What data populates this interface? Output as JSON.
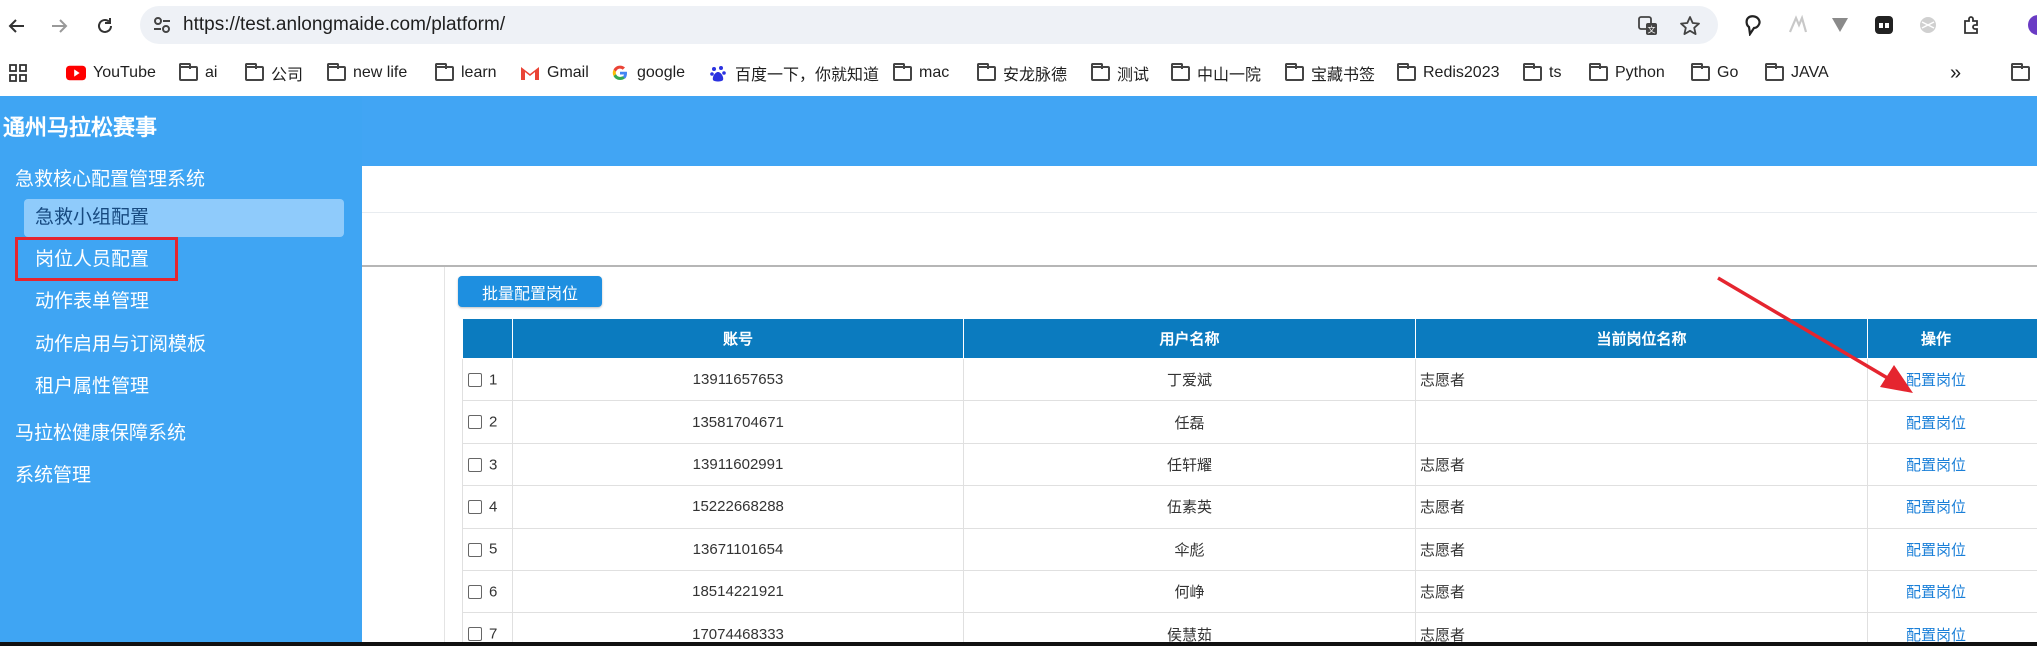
{
  "browser": {
    "url": "https://test.anlongmaide.com/platform/",
    "bookmarks": [
      {
        "label": "YouTube",
        "icon": "youtube-icon"
      },
      {
        "label": "ai",
        "icon": "folder-icon"
      },
      {
        "label": "公司",
        "icon": "folder-icon"
      },
      {
        "label": "new life",
        "icon": "folder-icon"
      },
      {
        "label": "learn",
        "icon": "folder-icon"
      },
      {
        "label": "Gmail",
        "icon": "gmail-icon"
      },
      {
        "label": "google",
        "icon": "google-icon"
      },
      {
        "label": "百度一下，你就知道",
        "icon": "baidu-icon"
      },
      {
        "label": "mac",
        "icon": "folder-icon"
      },
      {
        "label": "安龙脉德",
        "icon": "folder-icon"
      },
      {
        "label": "测试",
        "icon": "folder-icon"
      },
      {
        "label": "中山一院",
        "icon": "folder-icon"
      },
      {
        "label": "宝藏书签",
        "icon": "folder-icon"
      },
      {
        "label": "Redis2023",
        "icon": "folder-icon"
      },
      {
        "label": "ts",
        "icon": "folder-icon"
      },
      {
        "label": "Python",
        "icon": "folder-icon"
      },
      {
        "label": "Go",
        "icon": "folder-icon"
      },
      {
        "label": "JAVA",
        "icon": "folder-icon"
      }
    ],
    "overflow_label": "»"
  },
  "sidebar": {
    "brand": "通州马拉松赛事",
    "groups": [
      {
        "label": "急救核心配置管理系统"
      },
      {
        "label": "马拉松健康保障系统"
      },
      {
        "label": "系统管理"
      }
    ],
    "items": [
      {
        "label": "急救小组配置",
        "active": true
      },
      {
        "label": "岗位人员配置",
        "highlighted": true
      },
      {
        "label": "动作表单管理"
      },
      {
        "label": "动作启用与订阅模板"
      },
      {
        "label": "租户属性管理"
      }
    ]
  },
  "toolbar": {
    "batch_label": "批量配置岗位"
  },
  "table": {
    "columns": [
      "账号",
      "用户名称",
      "当前岗位名称",
      "操作"
    ],
    "rows": [
      {
        "no": "1",
        "account": "13911657653",
        "name": "丁爱斌",
        "post": "志愿者",
        "op": "配置岗位"
      },
      {
        "no": "2",
        "account": "13581704671",
        "name": "任磊",
        "post": "",
        "op": "配置岗位"
      },
      {
        "no": "3",
        "account": "13911602991",
        "name": "任轩耀",
        "post": "志愿者",
        "op": "配置岗位"
      },
      {
        "no": "4",
        "account": "15222668288",
        "name": "伍素英",
        "post": "志愿者",
        "op": "配置岗位"
      },
      {
        "no": "5",
        "account": "13671101654",
        "name": "伞彪",
        "post": "志愿者",
        "op": "配置岗位"
      },
      {
        "no": "6",
        "account": "18514221921",
        "name": "何峥",
        "post": "志愿者",
        "op": "配置岗位"
      },
      {
        "no": "7",
        "account": "17074468333",
        "name": "侯慧茹",
        "post": "志愿者",
        "op": "配置岗位"
      }
    ]
  },
  "colors": {
    "sidebar": "#3fa5f3",
    "header": "#41a5f4",
    "table_header": "#0b7bbf",
    "link": "#1a7fd8",
    "annotation": "#e5252f"
  }
}
